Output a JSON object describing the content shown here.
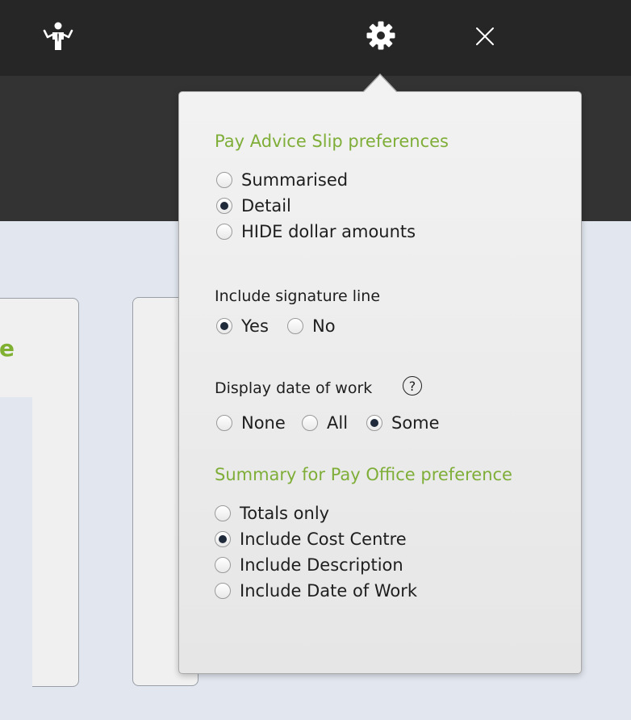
{
  "topbar": {
    "help_icon": "person-shrug-icon",
    "settings_icon": "gear-icon",
    "close_icon": "close-icon"
  },
  "background": {
    "card_left_fragment": "e"
  },
  "preferences": {
    "payslip_heading": "Pay Advice Slip preferences",
    "payslip_options": [
      {
        "label": "Summarised",
        "selected": false
      },
      {
        "label": "Detail",
        "selected": true
      },
      {
        "label": "HIDE dollar amounts",
        "selected": false
      }
    ],
    "signature_label": "Include signature line",
    "signature_options": [
      {
        "label": "Yes",
        "selected": true
      },
      {
        "label": "No",
        "selected": false
      }
    ],
    "date_label": "Display date of work",
    "date_help": "?",
    "date_options": [
      {
        "label": "None",
        "selected": false
      },
      {
        "label": "All",
        "selected": false
      },
      {
        "label": "Some",
        "selected": true
      }
    ],
    "summary_heading": "Summary for Pay Office preference",
    "summary_options": [
      {
        "label": "Totals only",
        "selected": false
      },
      {
        "label": "Include Cost Centre",
        "selected": true
      },
      {
        "label": "Include Description",
        "selected": false
      },
      {
        "label": "Include Date of Work",
        "selected": false
      }
    ]
  },
  "colors": {
    "accent_green": "#7fae38",
    "topbar": "#262626",
    "subbar": "#333333",
    "page_bg": "#e2e7ef"
  }
}
